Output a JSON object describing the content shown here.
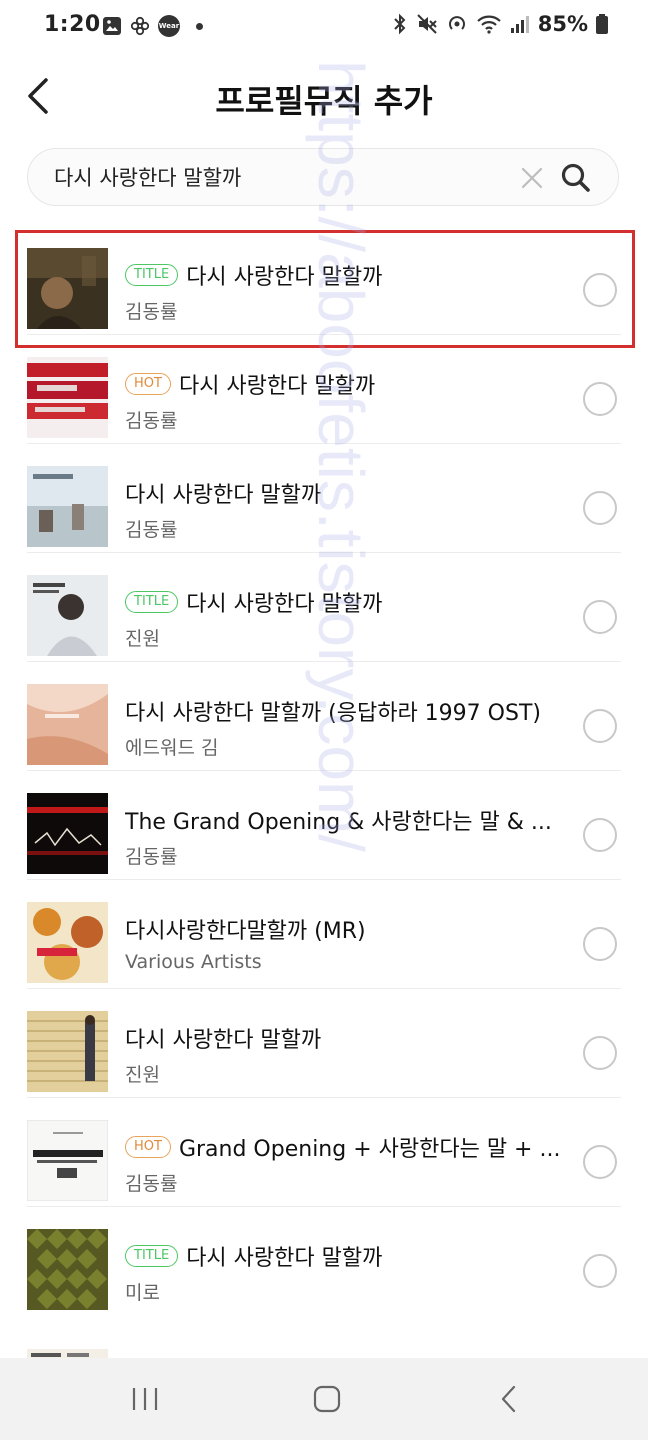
{
  "status_bar": {
    "time": "1:20",
    "battery": "85%",
    "wear_label": "Wear"
  },
  "header": {
    "title": "프로필뮤직 추가"
  },
  "search": {
    "value": "다시 사랑한다 말할까"
  },
  "songs": [
    {
      "badge": "TITLE",
      "title": "다시 사랑한다 말할까",
      "artist": "김동률",
      "selected": false,
      "highlighted": true
    },
    {
      "badge": "HOT",
      "title": "다시 사랑한다 말할까",
      "artist": "김동률",
      "selected": false
    },
    {
      "badge": "",
      "title": "다시 사랑한다 말할까",
      "artist": "김동률",
      "selected": false
    },
    {
      "badge": "TITLE",
      "title": "다시 사랑한다 말할까",
      "artist": "진원",
      "selected": false
    },
    {
      "badge": "",
      "title": "다시 사랑한다 말할까 (응답하라 1997 OST)",
      "artist": "에드워드 김",
      "selected": false
    },
    {
      "badge": "",
      "title": "The Grand Opening & 사랑한다는 말 & ...",
      "artist": "김동률",
      "selected": false
    },
    {
      "badge": "",
      "title": "다시사랑한다말할까 (MR)",
      "artist": "Various Artists",
      "selected": false
    },
    {
      "badge": "",
      "title": "다시 사랑한다 말할까",
      "artist": "진원",
      "selected": false
    },
    {
      "badge": "HOT",
      "title": "Grand Opening + 사랑한다는 말 + ...",
      "artist": "김동률",
      "selected": false
    },
    {
      "badge": "TITLE",
      "title": "다시 사랑한다 말할까",
      "artist": "미로",
      "selected": false
    }
  ],
  "watermark": "https://aboofetis.tistory.com/",
  "colors": {
    "title_badge": "#4cc764",
    "hot_badge": "#e08a3c",
    "highlight": "#d32f2f"
  }
}
